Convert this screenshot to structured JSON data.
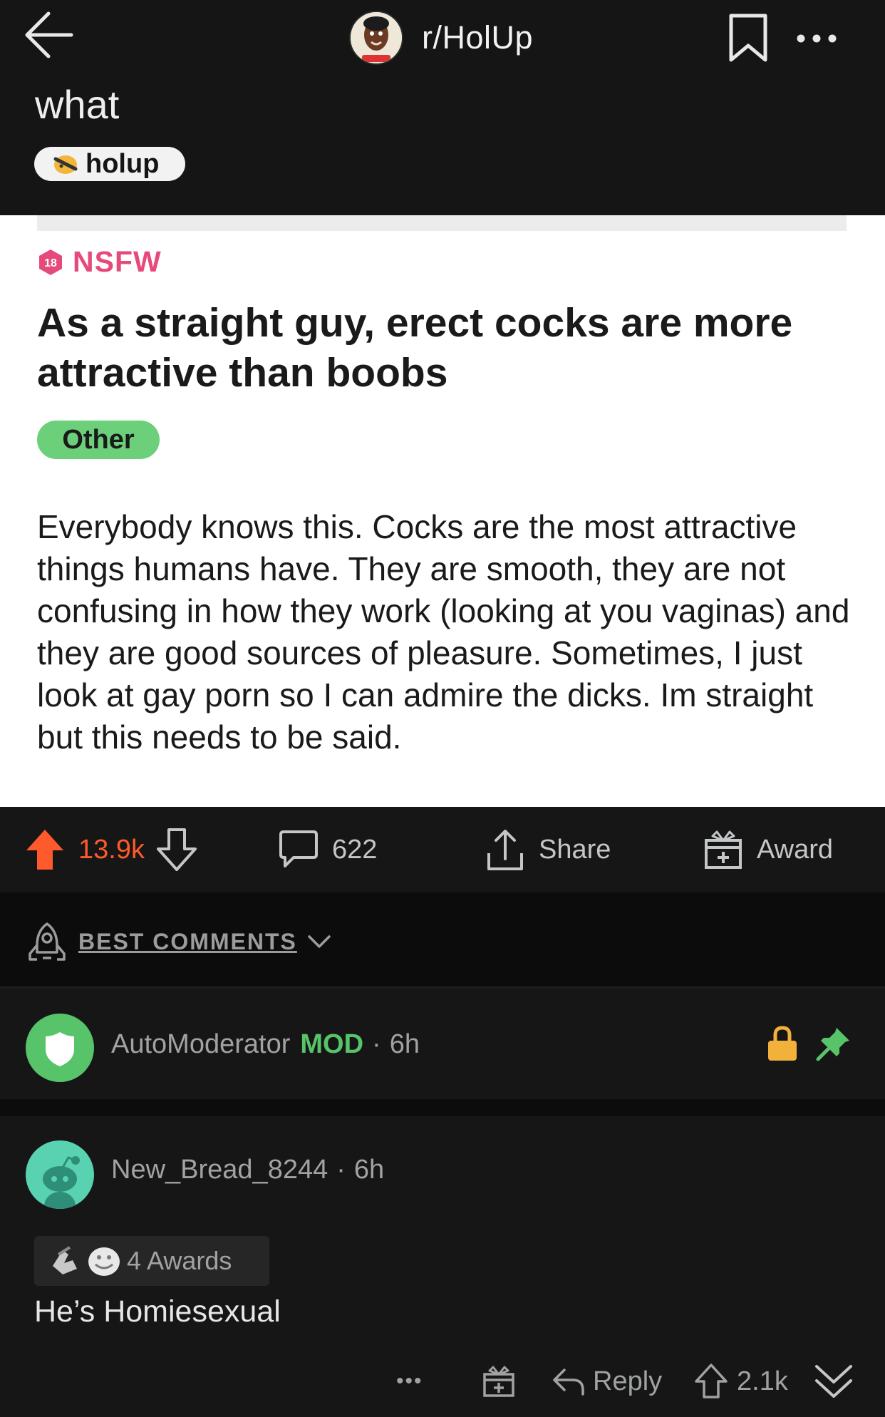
{
  "header": {
    "subreddit": "r/HolUp",
    "post_title": "what",
    "flair_label": "holup"
  },
  "screenshot": {
    "nsfw_label": "NSFW",
    "nsfw_badge": "18",
    "title": "As a straight guy, erect cocks are more attractive than boobs",
    "flair": "Other",
    "body": "Everybody knows this. Cocks are the most attractive things humans have. They are smooth, they are not confusing in how they work (looking at you vaginas) and they are good sources of pleasure. Sometimes, I just look at gay porn so I can admire the dicks. Im straight but this needs to be said."
  },
  "actions": {
    "upvotes": "13.9k",
    "comments": "622",
    "share_label": "Share",
    "award_label": "Award"
  },
  "sort": {
    "label": "BEST COMMENTS"
  },
  "automod": {
    "username": "AutoModerator",
    "mod_tag": "MOD",
    "dot": "·",
    "age": "6h"
  },
  "comment": {
    "username": "New_Bread_8244",
    "dot": "·",
    "age": "6h",
    "awards_label": "4 Awards",
    "body": "He’s Homiesexual",
    "more_label": "•••",
    "reply_label": "Reply",
    "score": "2.1k"
  },
  "colors": {
    "upvote": "#ff5a2b",
    "mod": "#58c46a",
    "nsfw": "#e64a7a",
    "lock": "#f2b13a",
    "pin": "#58c46a"
  },
  "icons": [
    "back-arrow-icon",
    "bookmark-icon",
    "more-icon",
    "upvote-icon",
    "downvote-icon",
    "comment-icon",
    "share-icon",
    "award-icon",
    "rocket-icon",
    "chevron-down-icon",
    "lock-icon",
    "pin-icon",
    "gift-icon",
    "reply-icon",
    "collapse-icon"
  ]
}
